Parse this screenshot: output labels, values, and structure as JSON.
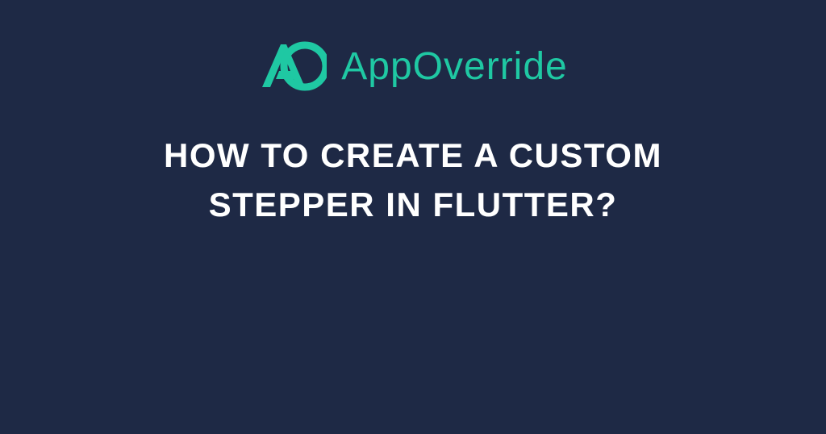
{
  "brand": {
    "name": "AppOverride"
  },
  "headline": {
    "text": "How to create a Custom Stepper in Flutter?"
  },
  "colors": {
    "background": "#1e2945",
    "accent": "#1fc8a3",
    "text": "#ffffff"
  }
}
